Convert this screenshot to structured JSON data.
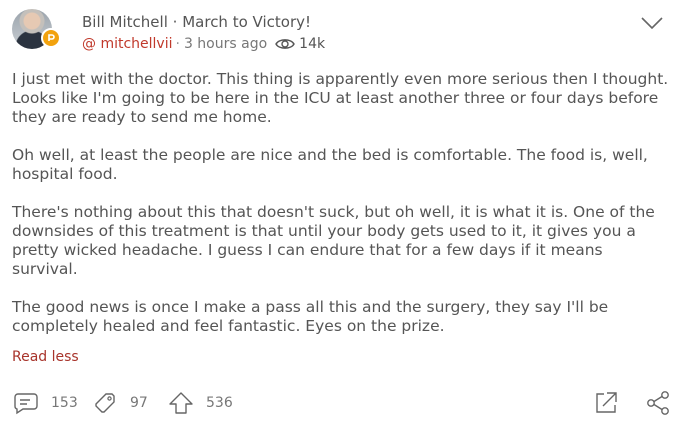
{
  "post": {
    "author_name": "Bill Mitchell",
    "separator": "·",
    "title": "March to Victory!",
    "handle": "@ mitchellvii",
    "meta_separator": "·",
    "time_ago": "3 hours ago",
    "views": "14k",
    "paragraphs": [
      "I just met with the doctor. This thing is apparently even more serious then I thought. Looks like I'm going to be here in the ICU at least another three or four days before they are ready to send me home.",
      "Oh well, at least the people are nice and the bed is comfortable. The food is, well, hospital food.",
      "There's nothing about this that doesn't suck, but oh well, it is what it is. One of the downsides of this treatment is that until your body gets used to it, it gives you a pretty wicked headache. I guess I can endure that for a few days if it means survival.",
      "The good news is once I make a pass all this and the surgery, they say I'll be completely healed and feel fantastic. Eyes on the prize."
    ],
    "read_less": "Read less"
  },
  "actions": {
    "comments": "153",
    "reposts": "97",
    "upvotes": "536"
  },
  "icons": {
    "menu": "chevron-down-icon",
    "views": "eye-icon",
    "comments": "comment-icon",
    "reposts": "repost-icon",
    "upvotes": "upvote-arrow-icon",
    "expand": "expand-icon",
    "share": "share-icon",
    "badge": "verified-badge-icon"
  },
  "colors": {
    "accent": "#c0392b",
    "badge": "#f2a20e",
    "text": "#555555"
  }
}
